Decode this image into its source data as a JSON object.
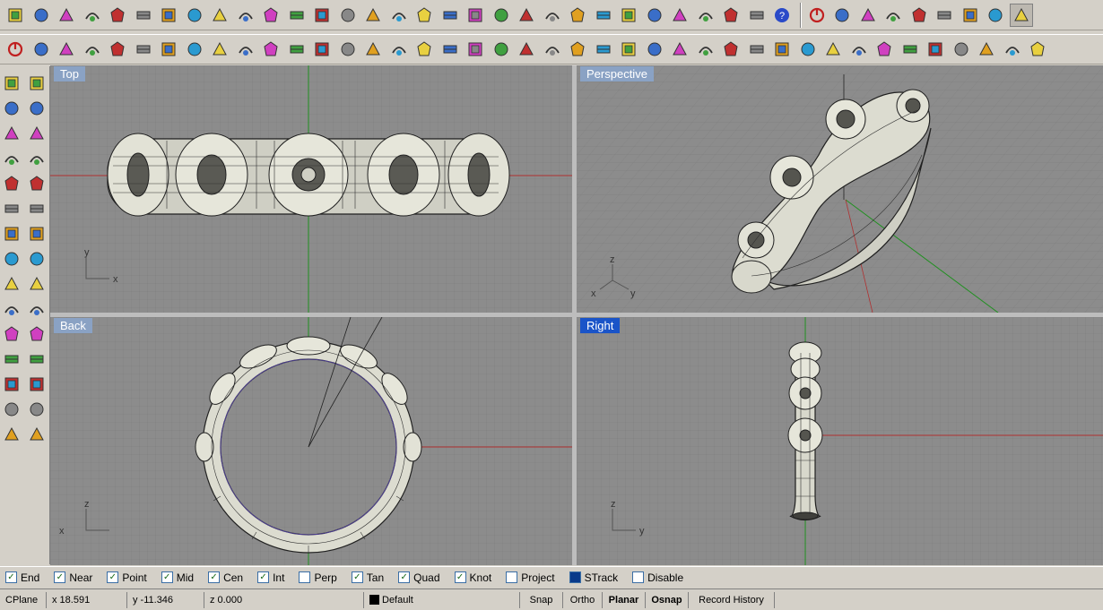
{
  "viewports": {
    "top": {
      "title": "Top",
      "axis_a": "y",
      "axis_b": "x"
    },
    "perspective": {
      "title": "Perspective",
      "axis_z": "z",
      "axis_x": "x",
      "axis_y": "y"
    },
    "back": {
      "title": "Back",
      "axis_a": "z",
      "axis_b": "x"
    },
    "right": {
      "title": "Right",
      "axis_a": "z",
      "axis_b": "y"
    }
  },
  "active_viewport": "right",
  "osnap": [
    {
      "label": "End",
      "checked": true
    },
    {
      "label": "Near",
      "checked": true
    },
    {
      "label": "Point",
      "checked": true
    },
    {
      "label": "Mid",
      "checked": true
    },
    {
      "label": "Cen",
      "checked": true
    },
    {
      "label": "Int",
      "checked": true
    },
    {
      "label": "Perp",
      "checked": false
    },
    {
      "label": "Tan",
      "checked": true
    },
    {
      "label": "Quad",
      "checked": true
    },
    {
      "label": "Knot",
      "checked": true
    },
    {
      "label": "Project",
      "checked": false
    },
    {
      "label": "STrack",
      "checked": true,
      "square": true
    },
    {
      "label": "Disable",
      "checked": false
    }
  ],
  "status": {
    "cplane": "CPlane",
    "x": "x 18.591",
    "y": "y -11.346",
    "z": "z 0.000",
    "layer": "Default",
    "snap": "Snap",
    "ortho": "Ortho",
    "planar": "Planar",
    "osnap": "Osnap",
    "record_history": "Record History"
  },
  "toolbar_main": [
    "new-icon",
    "open-icon",
    "save-icon",
    "print-icon",
    "import-icon",
    "cut-icon",
    "copy-icon",
    "paste-icon",
    "undo-icon",
    "pan-hand-icon",
    "rotate-view-icon",
    "zoom-icon",
    "zoom-window-icon",
    "zoom-extents-icon",
    "zoom-selected-icon",
    "undo-view-icon",
    "four-viewports-icon",
    "car-icon",
    "grid-icon",
    "circle-point-icon",
    "snap-icon",
    "light-bulb-icon",
    "render-shade-icon",
    "color-wheel-icon",
    "sphere-wire-icon",
    "sphere-grid-icon",
    "sphere-render-icon",
    "flag-icon",
    "gear-icon",
    "tree-icon",
    "help-icon"
  ],
  "toolbar_right": [
    "power-icon",
    "axis-icon",
    "target-icon",
    "nodes-icon",
    "cross-icon",
    "cube-wire-icon",
    "cube-icon",
    "cube-shaded-icon",
    "cube-render-icon"
  ],
  "toolbar_surface": [
    "on-icon",
    "box-pink-icon",
    "blob-icon",
    "arrows-icon",
    "frame-icon",
    "extrude-icon",
    "wave-icon",
    "bend-icon",
    "twist-icon",
    "loop-icon",
    "arch-icon",
    "bevel-icon",
    "panel-icon",
    "fold-icon",
    "split-icon",
    "solid-icon",
    "corner-icon",
    "merge-icon",
    "grid-pink-icon",
    "check-icon",
    "grid-lines-icon",
    "grid-big-icon",
    "grid-x-icon",
    "shear-icon",
    "mirror-icon",
    "stack-icon",
    "dots-icon",
    "edge-icon",
    "flow-icon",
    "star-icon",
    "twin-icon",
    "leaf-icon",
    "ring-icon",
    "spark-icon",
    "pentagon-icon",
    "facet-icon",
    "rope-icon",
    "sheet-icon",
    "knot-icon",
    "lid-icon",
    "puzzle-icon"
  ],
  "side_left": [
    "select-icon",
    "polyline-icon",
    "circle-icon",
    "curve-icon",
    "ellipse-icon",
    "surface-icon",
    "box-icon",
    "cylinder-icon",
    "transform-icon",
    "fillet-icon",
    "cluster-icon",
    "arc-tool-icon",
    "text-icon",
    "array-icon",
    "solid-box-icon"
  ],
  "side_right": [
    "point-icon",
    "rect-icon",
    "ellipse-tool-icon",
    "rectangle-icon",
    "offset-icon",
    "bend-tool-icon",
    "spheres-icon",
    "plane-icon",
    "explode-icon",
    "align-icon",
    "dots-tool-icon",
    "arc-offset-icon",
    "scale-icon",
    "dimension-icon",
    "grid-select-icon"
  ]
}
